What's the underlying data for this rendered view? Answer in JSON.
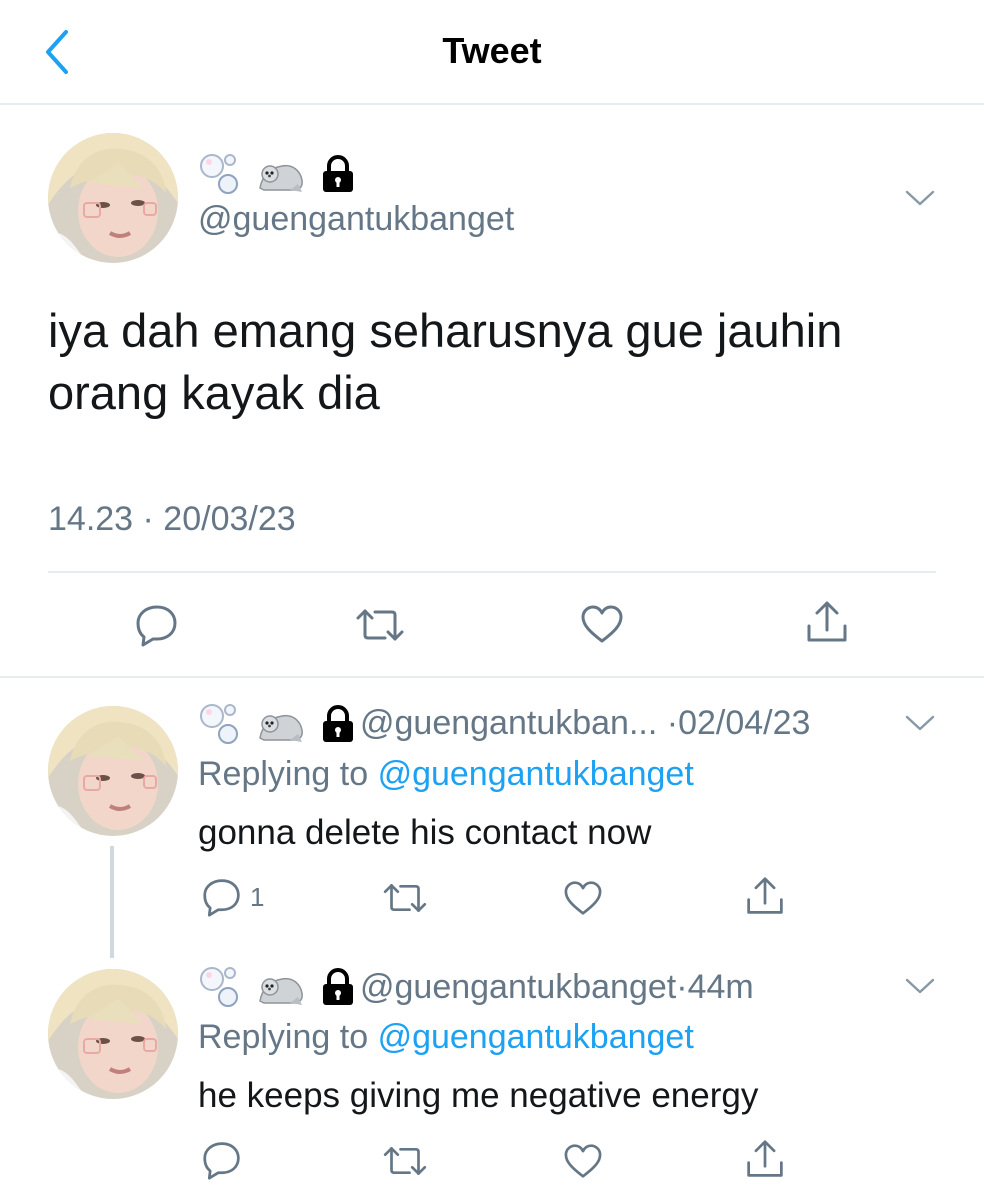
{
  "header": {
    "title": "Tweet"
  },
  "main_tweet": {
    "handle": "@guengantukbanget",
    "text": "iya dah emang seharusnya gue jauhin orang kayak dia",
    "timestamp": "14.23 · 20/03/23"
  },
  "replies": [
    {
      "handle": "@guengantukban...",
      "sep": "·",
      "time": "02/04/23",
      "replying_prefix": "Replying to",
      "replying_to": "@guengantukbanget",
      "text": "gonna delete his contact now",
      "reply_count": "1"
    },
    {
      "handle": "@guengantukbanget",
      "sep": "·",
      "time": "44m",
      "replying_prefix": "Replying to",
      "replying_to": "@guengantukbanget",
      "text": "he keeps giving me negative energy",
      "reply_count": ""
    }
  ],
  "name_emojis": [
    "bubbles-emoji",
    "seal-emoji",
    "lock-icon"
  ],
  "colors": {
    "accent": "#1da1f2",
    "muted": "#657786",
    "divider": "#e6ecf0",
    "text": "#14171a"
  }
}
